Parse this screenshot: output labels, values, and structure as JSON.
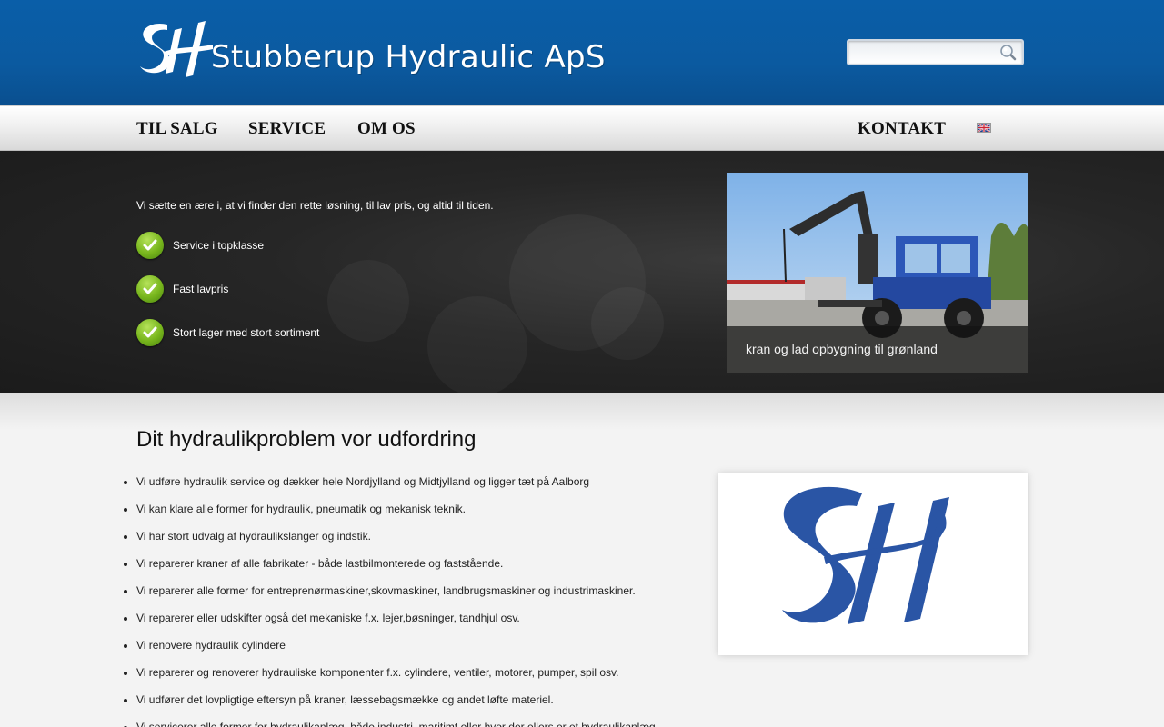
{
  "header": {
    "logo_text": "Stubberup Hydraulic ApS",
    "logo_initials": "SH",
    "search": {
      "value": "",
      "placeholder": ""
    }
  },
  "nav": {
    "items": [
      {
        "label": "TIL SALG"
      },
      {
        "label": "SERVICE"
      },
      {
        "label": "OM OS"
      }
    ],
    "contact_label": "KONTAKT",
    "language_icon": "uk-flag-icon"
  },
  "hero": {
    "tagline": "Vi sætte en ære i, at vi finder den rette løsning, til lav pris, og altid til tiden.",
    "features": [
      {
        "label": "Service i topklasse",
        "icon": "check-icon"
      },
      {
        "label": "Fast lavpris",
        "icon": "check-icon"
      },
      {
        "label": "Stort lager med stort sortiment",
        "icon": "check-icon"
      }
    ],
    "slide": {
      "caption": "kran og lad opbygning til grønland"
    }
  },
  "main": {
    "title": "Dit hydraulikproblem vor udfordring",
    "items": [
      "Vi udføre hydraulik service og dækker hele Nordjylland og Midtjylland og ligger tæt på Aalborg",
      "Vi kan klare alle former for hydraulik, pneumatik og mekanisk teknik.",
      "Vi har stort udvalg af hydraulikslanger og indstik.",
      "Vi reparerer kraner af alle fabrikater - både lastbilmonterede og faststående.",
      "Vi reparerer alle former for entreprenørmaskiner,skovmaskiner, landbrugsmaskiner og industrimaskiner.",
      "Vi reparerer eller udskifter også det mekaniske  f.x. lejer,bøsninger, tandhjul osv.",
      "Vi renovere hydraulik cylindere",
      "Vi reparerer og renoverer hydrauliske komponenter f.x. cylindere, ventiler, motorer, pumper, spil osv.",
      "Vi udfører det lovpligtige eftersyn på kraner, læssebagsmække og andet løfte materiel.",
      "Vi servicerer alle former for hydraulikanlæg, både industri, maritimt eller hvor der ellers er et hydraulikanlæg"
    ],
    "side_logo_initials": "SH"
  },
  "colors": {
    "header_blue": "#0b5aa0",
    "logo_blue": "#2a55a5",
    "check_green": "#77b51c",
    "hero_dark": "#262626"
  }
}
